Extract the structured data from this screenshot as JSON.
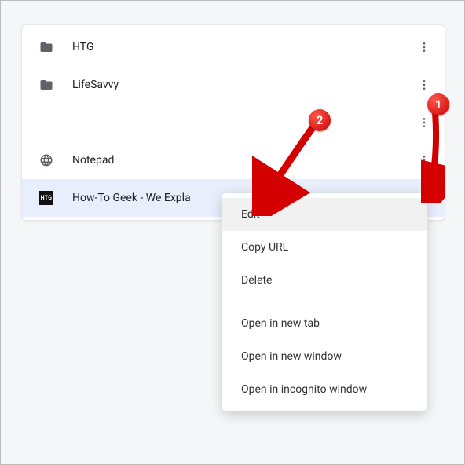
{
  "list": {
    "items": [
      {
        "type": "folder",
        "label": "HTG"
      },
      {
        "type": "folder",
        "label": "LifeSavvy"
      },
      {
        "type": "empty",
        "label": ""
      },
      {
        "type": "globe",
        "label": "Notepad"
      },
      {
        "type": "favicon",
        "label": "How-To Geek - We Expla",
        "selected": true
      }
    ]
  },
  "menu": {
    "items": [
      "Edit",
      "Copy URL",
      "Delete"
    ],
    "items2": [
      "Open in new tab",
      "Open in new window",
      "Open in incognito window"
    ],
    "hover_index": 0
  },
  "callouts": {
    "a": "1",
    "b": "2"
  }
}
